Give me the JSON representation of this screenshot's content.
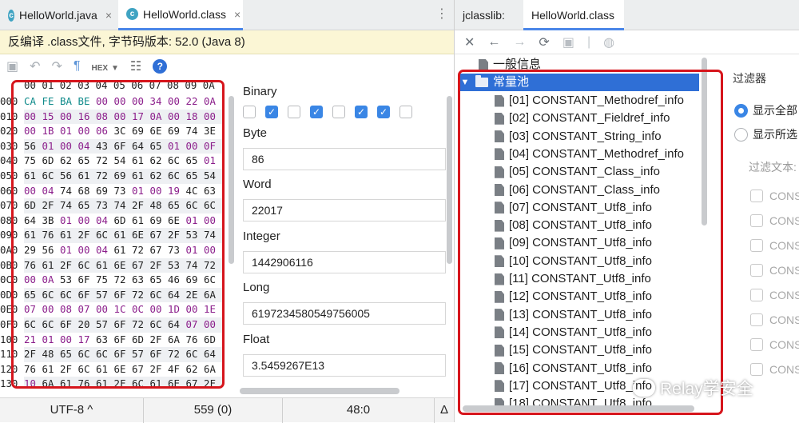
{
  "editor_tabs": [
    {
      "label": "HelloWorld.java",
      "active": false
    },
    {
      "label": "HelloWorld.class",
      "active": true
    }
  ],
  "banner": "反编译 .class文件, 字节码版本: 52.0 (Java 8)",
  "hex_toolbar": {
    "hex_label": "HEX",
    "help": "?"
  },
  "hex_header": "00 01 02 03 04 05 06 07 08 09 0A",
  "hex_addresses": [
    "000",
    "010",
    "020",
    "030",
    "040",
    "050",
    "060",
    "070",
    "080",
    "090",
    "0A0",
    "0B0",
    "0C0",
    "0D0",
    "0E0",
    "0F0",
    "100",
    "110",
    "120",
    "130",
    "140",
    "150"
  ],
  "hex_rows": [
    "CA FE BA BE 00 00 00 34 00 22 0A",
    "00 15 00 16 08 00 17 0A 00 18 00",
    "00 1B 01 00 06 3C 69 6E 69 74 3E",
    "56 01 00 04 43 6F 64 65 01 00 0F",
    "75 6D 62 65 72 54 61 62 6C 65 01",
    "61 6C 56 61 72 69 61 62 6C 65 54",
    "00 04 74 68 69 73 01 00 19 4C 63",
    "6D 2F 74 65 73 74 2F 48 65 6C 6C",
    "64 3B 01 00 04 6D 61 69 6E 01 00",
    "61 76 61 2F 6C 61 6E 67 2F 53 74",
    "29 56 01 00 04 61 72 67 73 01 00",
    "76 61 2F 6C 61 6E 67 2F 53 74 72",
    "00 0A 53 6F 75 72 63 65 46 69 6C",
    "65 6C 6C 6F 57 6F 72 6C 64 2E 6A",
    "07 00 08 07 00 1C 0C 00 1D 00 1E",
    "6C 6C 6F 20 57 6F 72 6C 64 07 00",
    "21 01 00 17 63 6F 6D 2F 6A 76 6D",
    "2F 48 65 6C 6C 6F 57 6F 72 6C 64",
    "76 61 2F 6C 61 6E 67 2F 4F 62 6A",
    "10 6A 61 76 61 2F 6C 61 6E 67 2F",
    "6D 01 00 03 6F 75 74 01 00 15 4C",
    "69 6F 2F 50 72 69 6E 74 53 74 72"
  ],
  "inspector": {
    "binary_label": "Binary",
    "bits": [
      false,
      true,
      false,
      true,
      false,
      true,
      true,
      false
    ],
    "byte_label": "Byte",
    "byte_value": "86",
    "word_label": "Word",
    "word_value": "22017",
    "integer_label": "Integer",
    "integer_value": "1442906116",
    "long_label": "Long",
    "long_value": "6197234580549756005",
    "float_label": "Float",
    "float_value": "3.5459267E13"
  },
  "status": {
    "encoding": "UTF-8 ^",
    "offset": "559 (0)",
    "position": "48:0",
    "delta": "Δ"
  },
  "jclasslib": {
    "title": "jclasslib:",
    "tab": "HelloWorld.class",
    "tree": {
      "general": "一般信息",
      "pool": "常量池",
      "entries": [
        "[01] CONSTANT_Methodref_info",
        "[02] CONSTANT_Fieldref_info",
        "[03] CONSTANT_String_info",
        "[04] CONSTANT_Methodref_info",
        "[05] CONSTANT_Class_info",
        "[06] CONSTANT_Class_info",
        "[07] CONSTANT_Utf8_info",
        "[08] CONSTANT_Utf8_info",
        "[09] CONSTANT_Utf8_info",
        "[10] CONSTANT_Utf8_info",
        "[11] CONSTANT_Utf8_info",
        "[12] CONSTANT_Utf8_info",
        "[13] CONSTANT_Utf8_info",
        "[14] CONSTANT_Utf8_info",
        "[15] CONSTANT_Utf8_info",
        "[16] CONSTANT_Utf8_info",
        "[17] CONSTANT_Utf8_info",
        "[18] CONSTANT_Utf8_info"
      ]
    },
    "filter": {
      "title": "过滤器",
      "show_all": "显示全部",
      "show_selected": "显示所选",
      "text_label": "过滤文本:",
      "cons": [
        "CONS",
        "CONS",
        "CONS",
        "CONS",
        "CONS",
        "CONS",
        "CONS",
        "CONS"
      ]
    }
  },
  "watermark": "Relay学安全",
  "colors": {
    "highlight_red": "#d6151c",
    "selection_blue": "#2f6fd6",
    "banner_yellow": "#fbf6d5"
  }
}
